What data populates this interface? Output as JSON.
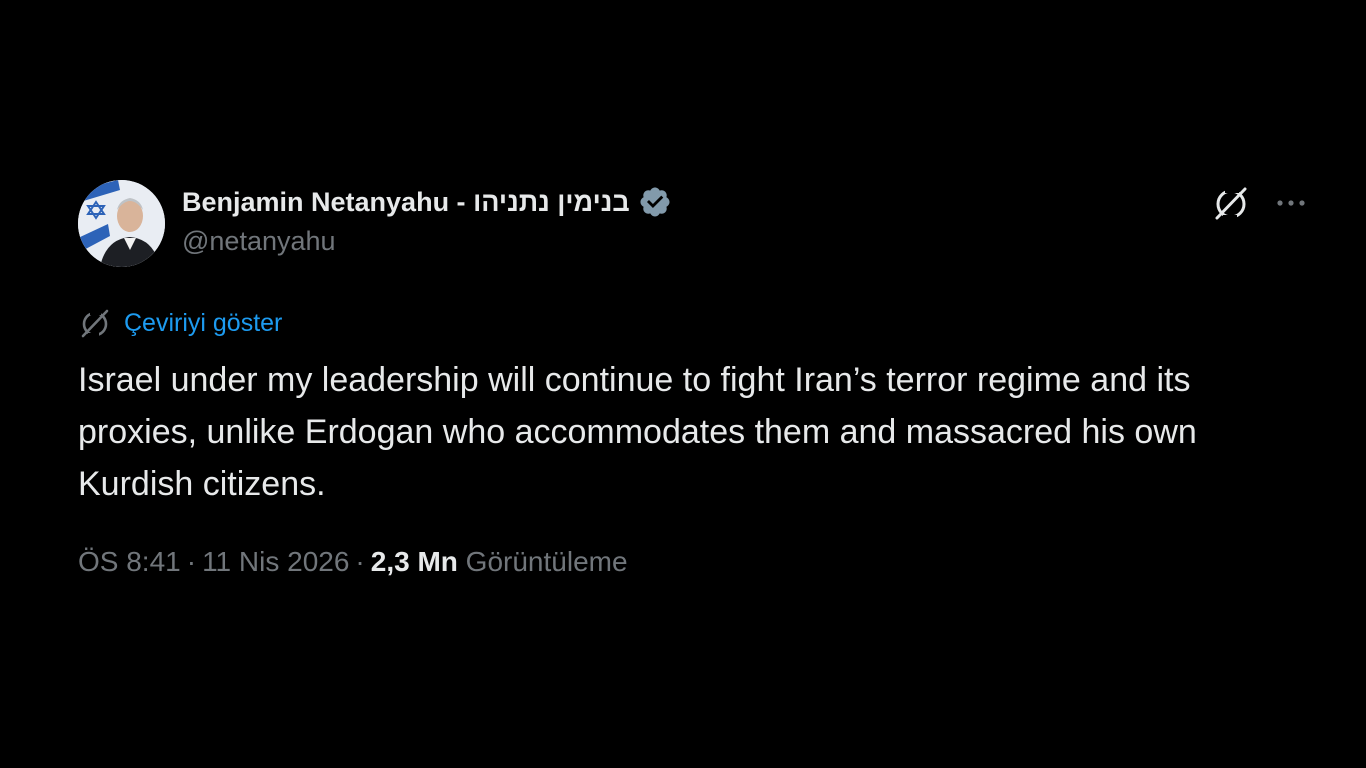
{
  "author": {
    "display_name": "Benjamin Netanyahu - בנימין נתניהו",
    "handle": "@netanyahu",
    "verified": true
  },
  "icons": {
    "verified": "verified-badge-icon",
    "grok": "grok-icon",
    "more": "more-options-icon",
    "translate": "translate-icon"
  },
  "translate_label": "Çeviriyi göster",
  "text": "Israel under my leadership will continue to fight Iran’s terror regime and its proxies, unlike Erdogan who accommodates them and massacred his own Kurdish citizens.",
  "meta": {
    "time": "ÖS 8:41",
    "date": "11 Nis 2026",
    "views_count": "2,3 Mn",
    "views_label": "Görüntüleme"
  },
  "colors": {
    "background": "#000000",
    "primary_text": "#e7e9ea",
    "secondary_text": "#71767b",
    "link": "#1d9bf0",
    "verified_badge": "#829aab"
  }
}
